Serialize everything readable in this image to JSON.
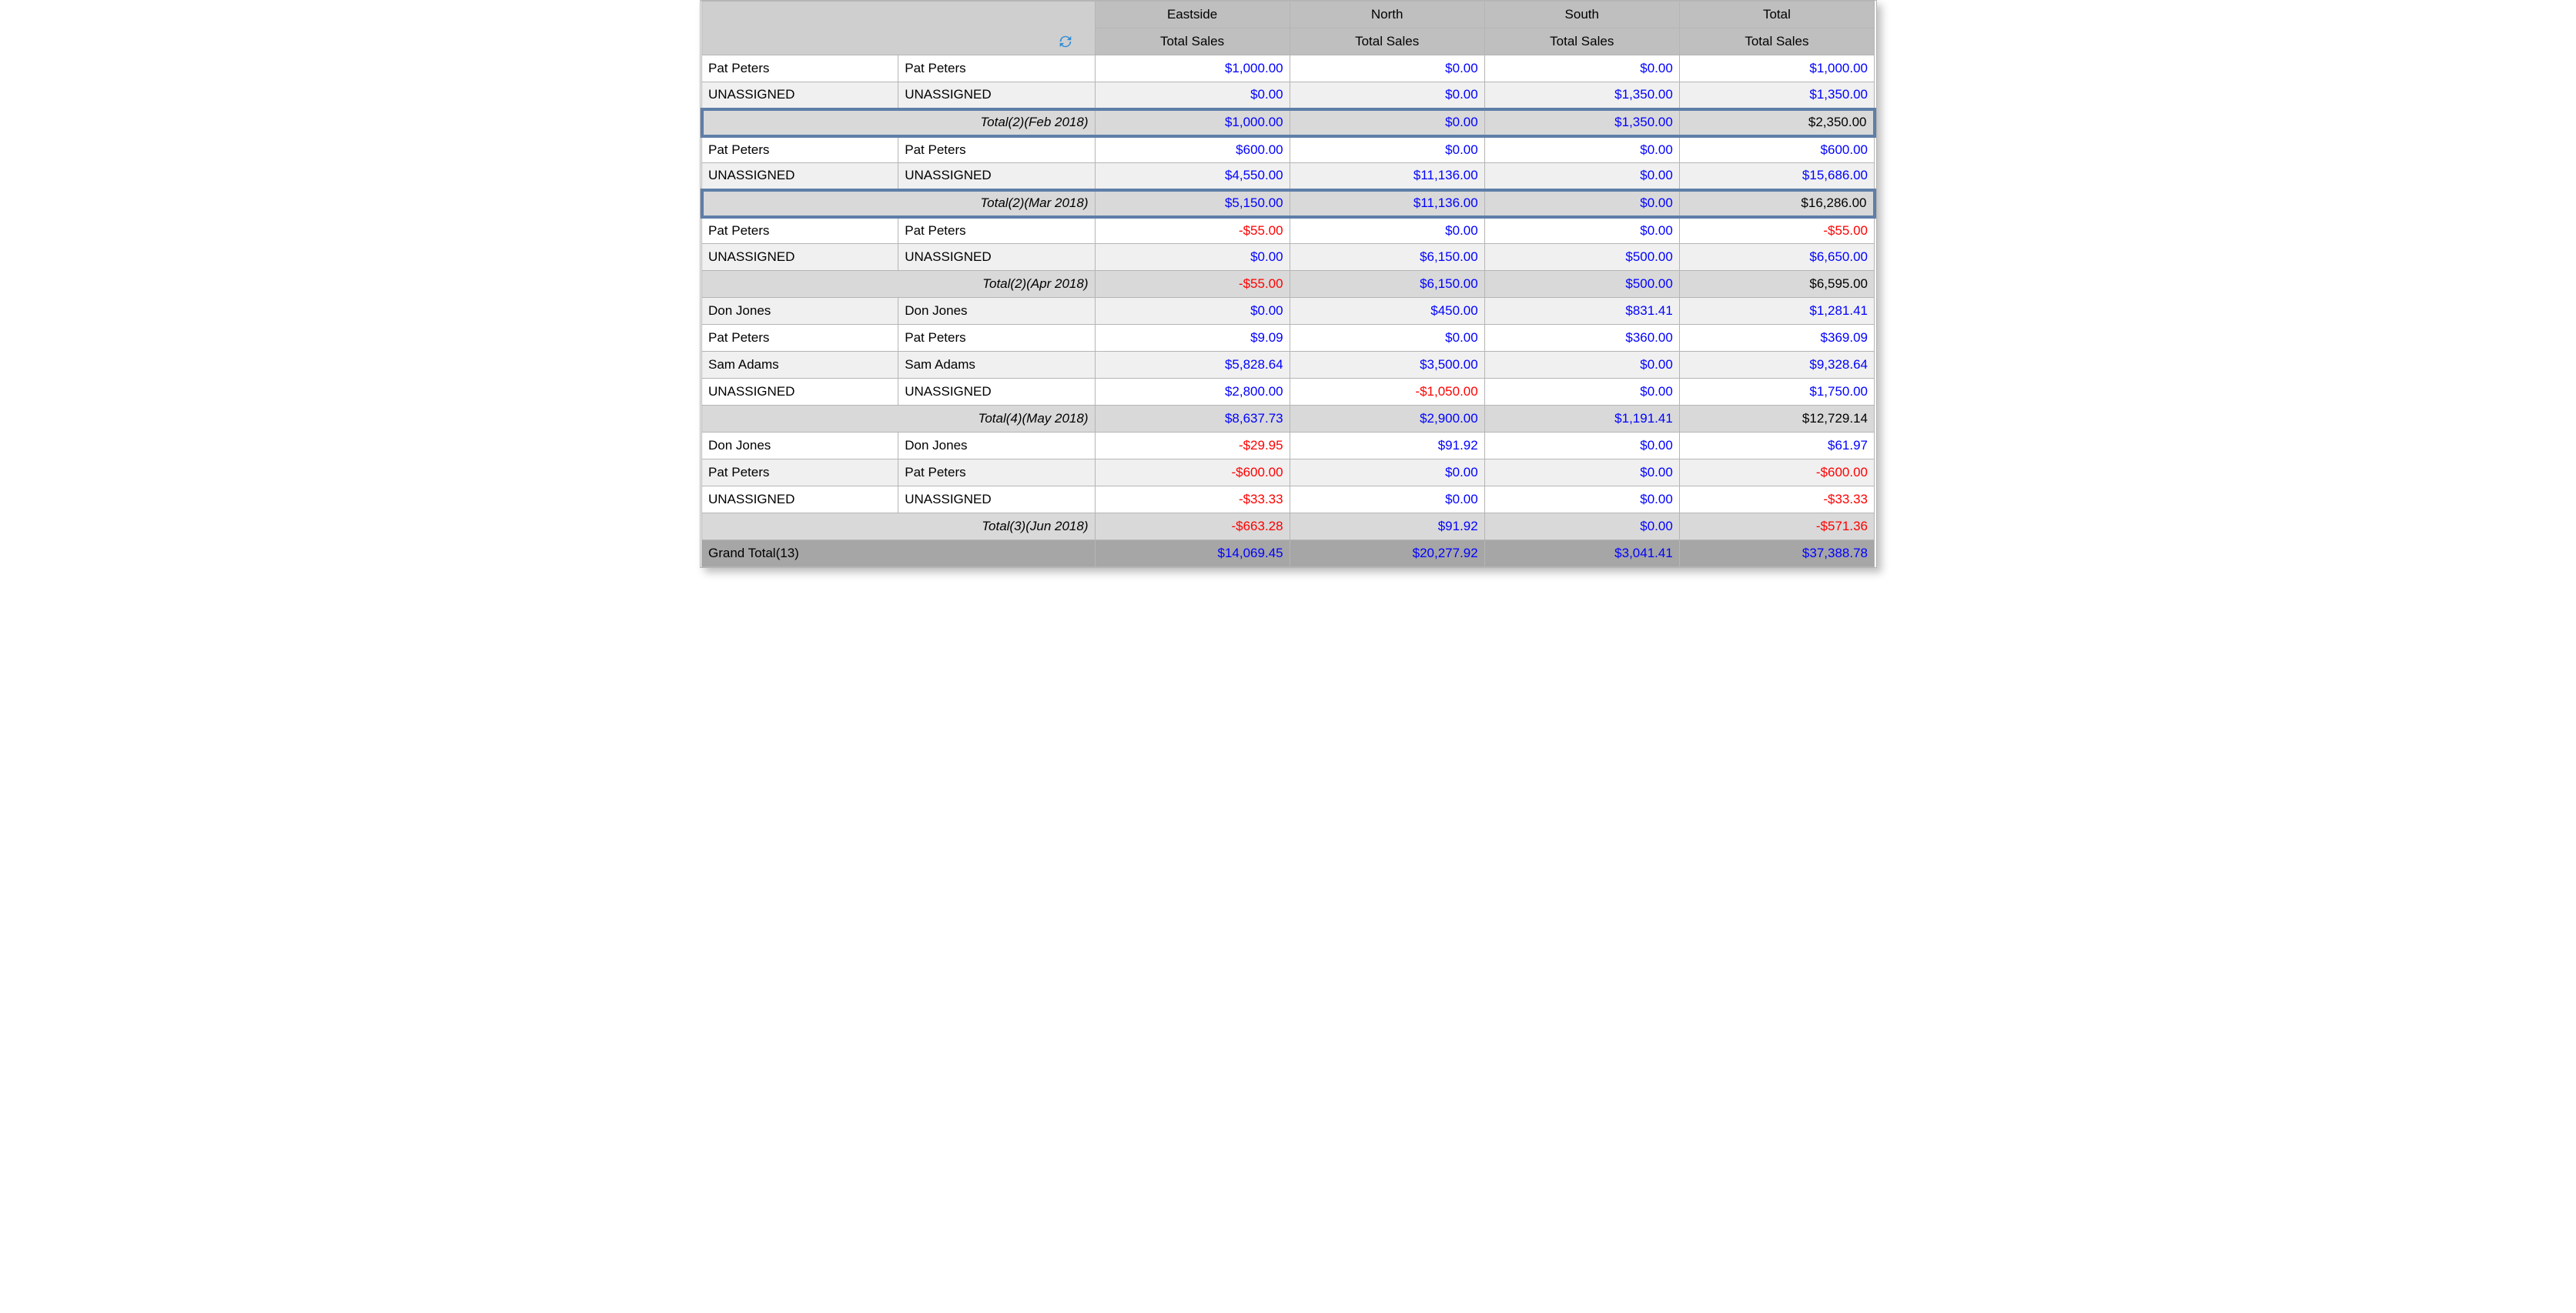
{
  "columns": {
    "regions": [
      "Eastside",
      "North",
      "South",
      "Total"
    ],
    "measure": "Total Sales"
  },
  "groups": [
    {
      "highlight": true,
      "rows": [
        {
          "shade": "white",
          "c0": "Pat Peters",
          "c1": "Pat Peters",
          "v": [
            "$1,000.00",
            "$0.00",
            "$0.00",
            "$1,000.00"
          ],
          "vneg": [
            false,
            false,
            false,
            false
          ]
        },
        {
          "shade": "light",
          "c0": "UNASSIGNED",
          "c1": "UNASSIGNED",
          "v": [
            "$0.00",
            "$0.00",
            "$1,350.00",
            "$1,350.00"
          ],
          "vneg": [
            false,
            false,
            false,
            false
          ]
        }
      ],
      "subtotal": {
        "label": "Total(2)(Feb 2018)",
        "v": [
          "$1,000.00",
          "$0.00",
          "$1,350.00",
          "$2,350.00"
        ],
        "style": [
          "blue",
          "blue",
          "blue",
          "black"
        ]
      }
    },
    {
      "highlight": true,
      "rows": [
        {
          "shade": "white",
          "c0": "Pat Peters",
          "c1": "Pat Peters",
          "v": [
            "$600.00",
            "$0.00",
            "$0.00",
            "$600.00"
          ],
          "vneg": [
            false,
            false,
            false,
            false
          ]
        },
        {
          "shade": "light",
          "c0": "UNASSIGNED",
          "c1": "UNASSIGNED",
          "v": [
            "$4,550.00",
            "$11,136.00",
            "$0.00",
            "$15,686.00"
          ],
          "vneg": [
            false,
            false,
            false,
            false
          ]
        }
      ],
      "subtotal": {
        "label": "Total(2)(Mar 2018)",
        "v": [
          "$5,150.00",
          "$11,136.00",
          "$0.00",
          "$16,286.00"
        ],
        "style": [
          "blue",
          "blue",
          "blue",
          "black"
        ]
      }
    },
    {
      "highlight": false,
      "rows": [
        {
          "shade": "white",
          "c0": "Pat Peters",
          "c1": "Pat Peters",
          "v": [
            "-$55.00",
            "$0.00",
            "$0.00",
            "-$55.00"
          ],
          "vneg": [
            true,
            false,
            false,
            true
          ]
        },
        {
          "shade": "light",
          "c0": "UNASSIGNED",
          "c1": "UNASSIGNED",
          "v": [
            "$0.00",
            "$6,150.00",
            "$500.00",
            "$6,650.00"
          ],
          "vneg": [
            false,
            false,
            false,
            false
          ]
        }
      ],
      "subtotal": {
        "label": "Total(2)(Apr 2018)",
        "v": [
          "-$55.00",
          "$6,150.00",
          "$500.00",
          "$6,595.00"
        ],
        "style": [
          "red",
          "blue",
          "blue",
          "black"
        ]
      }
    },
    {
      "highlight": false,
      "rows": [
        {
          "shade": "light",
          "c0": "Don Jones",
          "c1": "Don Jones",
          "v": [
            "$0.00",
            "$450.00",
            "$831.41",
            "$1,281.41"
          ],
          "vneg": [
            false,
            false,
            false,
            false
          ]
        },
        {
          "shade": "white",
          "c0": "Pat Peters",
          "c1": "Pat Peters",
          "v": [
            "$9.09",
            "$0.00",
            "$360.00",
            "$369.09"
          ],
          "vneg": [
            false,
            false,
            false,
            false
          ]
        },
        {
          "shade": "light",
          "c0": "Sam Adams",
          "c1": "Sam Adams",
          "v": [
            "$5,828.64",
            "$3,500.00",
            "$0.00",
            "$9,328.64"
          ],
          "vneg": [
            false,
            false,
            false,
            false
          ]
        },
        {
          "shade": "white",
          "c0": "UNASSIGNED",
          "c1": "UNASSIGNED",
          "v": [
            "$2,800.00",
            "-$1,050.00",
            "$0.00",
            "$1,750.00"
          ],
          "vneg": [
            false,
            true,
            false,
            false
          ]
        }
      ],
      "subtotal": {
        "label": "Total(4)(May 2018)",
        "v": [
          "$8,637.73",
          "$2,900.00",
          "$1,191.41",
          "$12,729.14"
        ],
        "style": [
          "blue",
          "blue",
          "blue",
          "black"
        ]
      }
    },
    {
      "highlight": false,
      "rows": [
        {
          "shade": "white",
          "c0": "Don Jones",
          "c1": "Don Jones",
          "v": [
            "-$29.95",
            "$91.92",
            "$0.00",
            "$61.97"
          ],
          "vneg": [
            true,
            false,
            false,
            false
          ]
        },
        {
          "shade": "light",
          "c0": "Pat Peters",
          "c1": "Pat Peters",
          "v": [
            "-$600.00",
            "$0.00",
            "$0.00",
            "-$600.00"
          ],
          "vneg": [
            true,
            false,
            false,
            true
          ]
        },
        {
          "shade": "white",
          "c0": "UNASSIGNED",
          "c1": "UNASSIGNED",
          "v": [
            "-$33.33",
            "$0.00",
            "$0.00",
            "-$33.33"
          ],
          "vneg": [
            true,
            false,
            false,
            true
          ]
        }
      ],
      "subtotal": {
        "label": "Total(3)(Jun 2018)",
        "v": [
          "-$663.28",
          "$91.92",
          "$0.00",
          "-$571.36"
        ],
        "style": [
          "red",
          "blue",
          "blue",
          "red"
        ]
      }
    }
  ],
  "grand": {
    "label": "Grand Total(13)",
    "v": [
      "$14,069.45",
      "$20,277.92",
      "$3,041.41",
      "$37,388.78"
    ]
  }
}
